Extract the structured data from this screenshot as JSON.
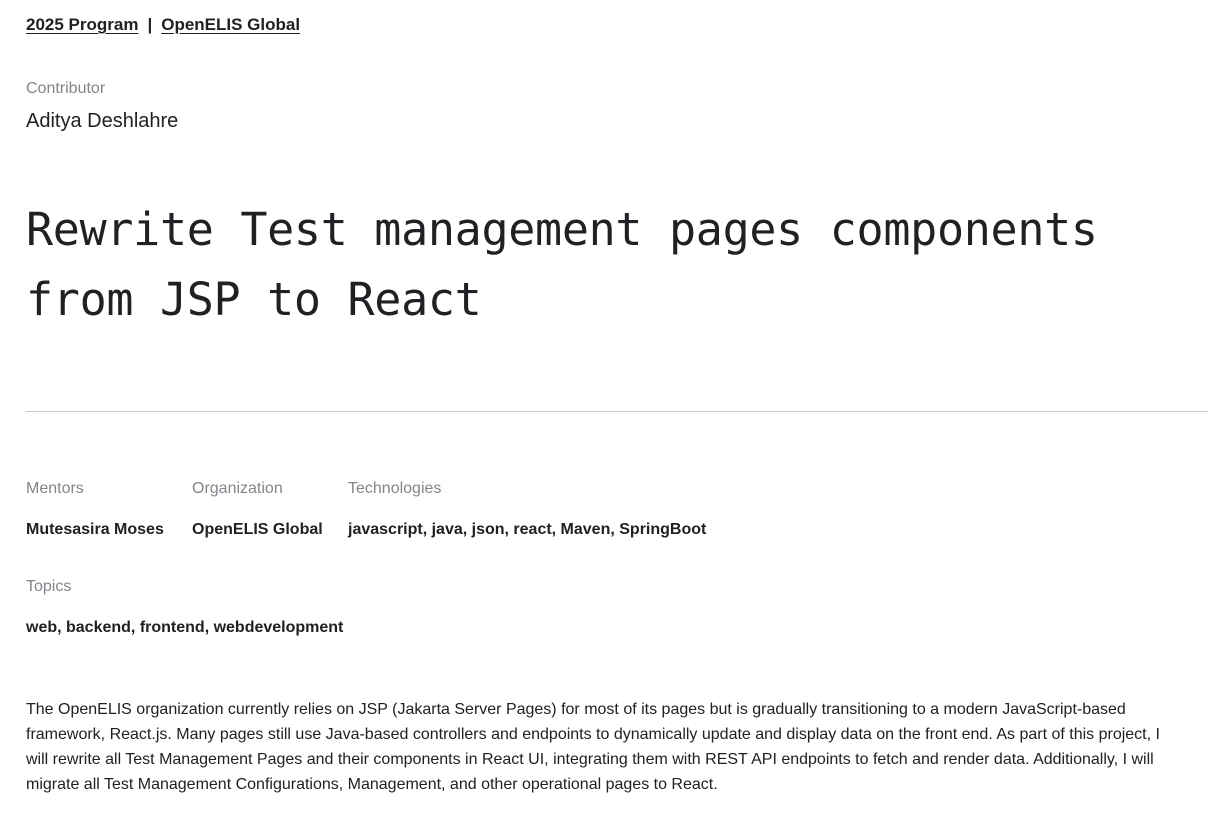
{
  "breadcrumb": {
    "program": "2025 Program",
    "separator": "|",
    "organization": "OpenELIS Global"
  },
  "contributor": {
    "label": "Contributor",
    "name": "Aditya Deshlahre"
  },
  "project": {
    "title": "Rewrite Test management pages components from JSP to React"
  },
  "meta": {
    "mentors": {
      "label": "Mentors",
      "value": "Mutesasira Moses"
    },
    "organization": {
      "label": "Organization",
      "value": "OpenELIS Global"
    },
    "technologies": {
      "label": "Technologies",
      "value": "javascript, java, json, react, Maven, SpringBoot"
    },
    "topics": {
      "label": "Topics",
      "value": "web, backend, frontend, webdevelopment"
    }
  },
  "description": "The OpenELIS organization currently relies on JSP (Jakarta Server Pages) for most of its pages but is gradually transitioning to a modern JavaScript-based framework, React.js. Many pages still use Java-based controllers and endpoints to dynamically update and display data on the front end. As part of this project, I will rewrite all Test Management Pages and their components in React UI, integrating them with REST API endpoints to fetch and render data. Additionally, I will migrate all Test Management Configurations, Management, and other operational pages to React."
}
